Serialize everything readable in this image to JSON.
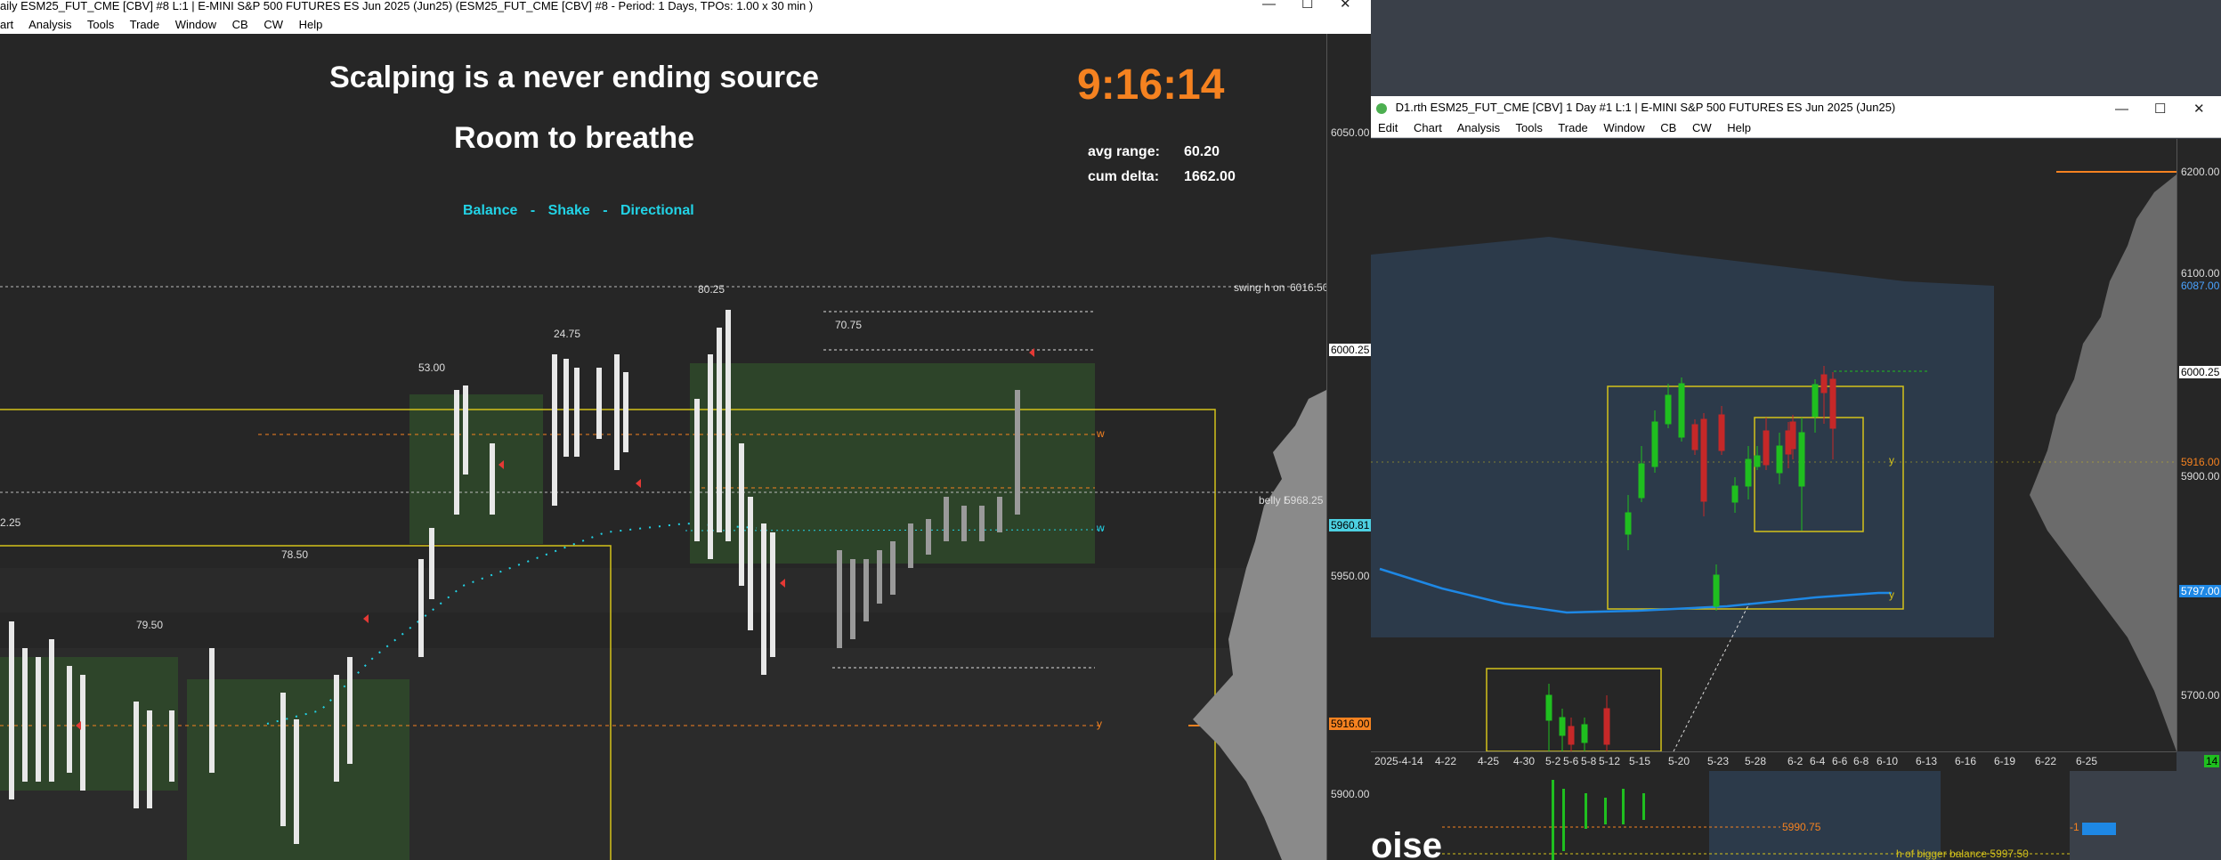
{
  "win1": {
    "title": "aily ESM25_FUT_CME [CBV] #8 L:1 | E-MINI S&P 500 FUTURES ES Jun 2025 (Jun25) (ESM25_FUT_CME [CBV] #8 - Period: 1 Days, TPOs: 1.00 x 30 min )",
    "menu": [
      "art",
      "Analysis",
      "Tools",
      "Trade",
      "Window",
      "CB",
      "CW",
      "Help"
    ],
    "controls": {
      "minimize": "—",
      "maximize": "☐",
      "close": "✕"
    },
    "headline1": "Scalping is a never ending source",
    "headline2": "Room to breathe",
    "clock": "9:16:14",
    "avg_range_label": "avg range:",
    "avg_range_value": "60.20",
    "cum_delta_label": "cum delta:",
    "cum_delta_value": "1662.00",
    "modes": {
      "balance": "Balance",
      "sep1": "-",
      "shake": "Shake",
      "sep2": "-",
      "directional": "Directional"
    },
    "range_labels": {
      "r1": "80.25",
      "r2": "70.75",
      "r3": "24.75",
      "r4": "53.00",
      "r5": "78.50",
      "r6": "79.50",
      "r7": "2.25"
    },
    "level_labels": {
      "swing": "swing h on",
      "swing_price": "6016.50",
      "belly": "belly l",
      "belly_price": "5968.25",
      "w1": "w",
      "w2": "w",
      "y1": "y"
    },
    "axis": {
      "t6050": "6050.00",
      "t6000": "6000.25",
      "t5960": "5960.81",
      "t5950": "5950.00",
      "t5916": "5916.00",
      "t5900": "5900.00"
    },
    "colors": {
      "accent_orange": "#f58220",
      "cyan": "#22d3e6",
      "yellow_box": "#d4c21a",
      "green_zone": "#2f4a2a",
      "sell_marker": "#e53935"
    }
  },
  "win2": {
    "title": "D1.rth ESM25_FUT_CME [CBV]  1 Day  #1 L:1 | E-MINI S&P 500 FUTURES ES Jun 2025 (Jun25)",
    "menu": [
      "Edit",
      "Chart",
      "Analysis",
      "Tools",
      "Trade",
      "Window",
      "CB",
      "CW",
      "Help"
    ],
    "controls": {
      "minimize": "—",
      "maximize": "☐",
      "close": "✕"
    },
    "axis": {
      "t6200": "6200.00",
      "t6100": "6100.00",
      "t6087": "6087.00",
      "t6000": "6000.25",
      "t5916": "5916.00",
      "t5900": "5900.00",
      "t5797": "5797.00",
      "t5700": "5700.00"
    },
    "marks": {
      "y1": "y",
      "y2": "y"
    },
    "dates": [
      "2025-4-14",
      "4-22",
      "4-25",
      "4-30",
      "5-2",
      "5-6",
      "5-8",
      "5-12",
      "5-15",
      "5-20",
      "5-23",
      "5-28",
      "6-2",
      "6-4",
      "6-6",
      "6-8",
      "6-10",
      "6-13",
      "6-16",
      "6-19",
      "6-22",
      "6-25"
    ],
    "badge": "14",
    "colors": {
      "bull": "#1fbf1f",
      "bear": "#c62828",
      "ma_line": "#1e88e5",
      "box": "#d4c21a"
    }
  },
  "bottom_window": {
    "big_text": "oise",
    "price_label": "5990.75",
    "note": "h of bigger balance 5997.50",
    "marker": "-1"
  }
}
